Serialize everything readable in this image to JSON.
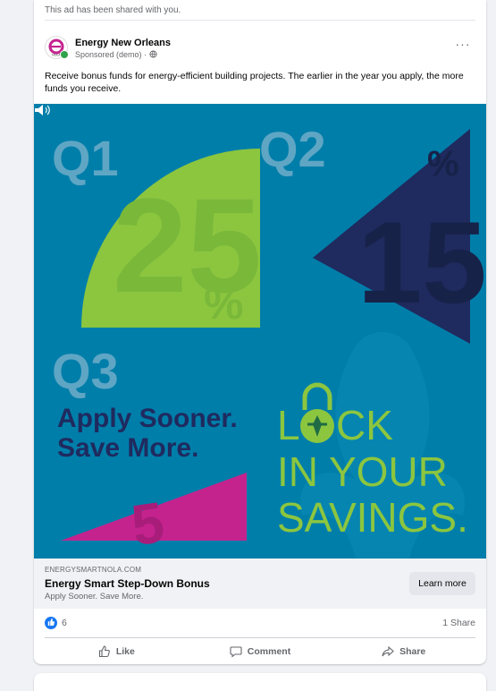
{
  "post": {
    "shared_note": "This ad has been shared with you.",
    "page_name": "Energy New Orleans",
    "sponsored": "Sponsored (demo) · ",
    "more_label": "···",
    "text": "Receive bonus funds for energy-efficient building projects. The earlier in the year you apply, the more funds you receive."
  },
  "creative": {
    "q1": "Q1",
    "q2": "Q2",
    "q3": "Q3",
    "pct_25": "25",
    "pct_15": "15",
    "pct_5": "5",
    "pct_sign": "%",
    "headline_1": "Apply Sooner.",
    "headline_2": "Save More.",
    "lock_1a": "L",
    "lock_1b": "CK",
    "lock_2": "IN YOUR",
    "lock_3": "SAVINGS.",
    "colors": {
      "background": "#007eaa",
      "green": "#8cc63f",
      "navy": "#1f2a5e",
      "magenta": "#c4238e",
      "light_text": "#5fa6c4"
    }
  },
  "link": {
    "domain": "ENERGYSMARTNOLA.COM",
    "title": "Energy Smart Step-Down Bonus",
    "description": "Apply Sooner. Save More.",
    "cta": "Learn more"
  },
  "stats": {
    "like_count": "6",
    "share_count": "1 Share"
  },
  "actions": {
    "like": "Like",
    "comment": "Comment",
    "share": "Share"
  },
  "icons": {
    "like": "thumbs-up-icon",
    "comment": "comment-icon",
    "share": "share-icon",
    "globe": "globe-icon",
    "speaker": "speaker-icon"
  }
}
